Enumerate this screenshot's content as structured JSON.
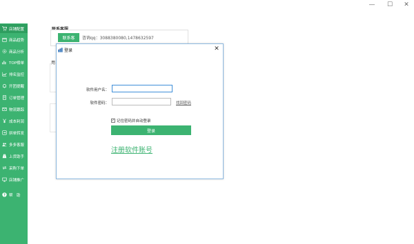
{
  "window": {
    "minimize": "—",
    "maximize": "☐",
    "close": "✕"
  },
  "sidebar": {
    "items": [
      {
        "label": "店铺配置",
        "icon": "cart-icon"
      },
      {
        "label": "商品趋势",
        "icon": "package-icon"
      },
      {
        "label": "商品分析",
        "icon": "gear-icon"
      },
      {
        "label": "TOP榜单",
        "icon": "top-icon"
      },
      {
        "label": "排名监控",
        "icon": "trend-icon"
      },
      {
        "label": "开团提醒",
        "icon": "bell-icon"
      },
      {
        "label": "订单管理",
        "icon": "document-icon"
      },
      {
        "label": "物流跟踪",
        "icon": "mail-icon"
      },
      {
        "label": "成本利润",
        "icon": "yen-icon"
      },
      {
        "label": "拼单转发",
        "icon": "forward-icon"
      },
      {
        "label": "多多客服",
        "icon": "users-icon"
      },
      {
        "label": "上货助手",
        "icon": "road-icon"
      },
      {
        "label": "采购下单",
        "icon": "exchange-icon"
      },
      {
        "label": "店铺推广",
        "icon": "monitor-icon"
      },
      {
        "label": "帮　助",
        "icon": "help-icon"
      }
    ]
  },
  "background": {
    "section_title": "联系客服",
    "contact_button": "联系客",
    "contact_text": "咨询qq：3088380080,1478632597",
    "fragment": "用"
  },
  "dialog": {
    "title": "登录",
    "username_label": "软件用户名：",
    "username_value": "",
    "password_label": "软件密码：",
    "password_value": "",
    "forgot_link": "找回密码",
    "remember_label": "记住密码并自动登录",
    "remember_checked": true,
    "login_button": "登录",
    "register_link": "注册软件账号"
  },
  "colors": {
    "accent": "#3cb371",
    "dialog_border": "#8cb8df",
    "focus_border": "#3c8dd8"
  }
}
